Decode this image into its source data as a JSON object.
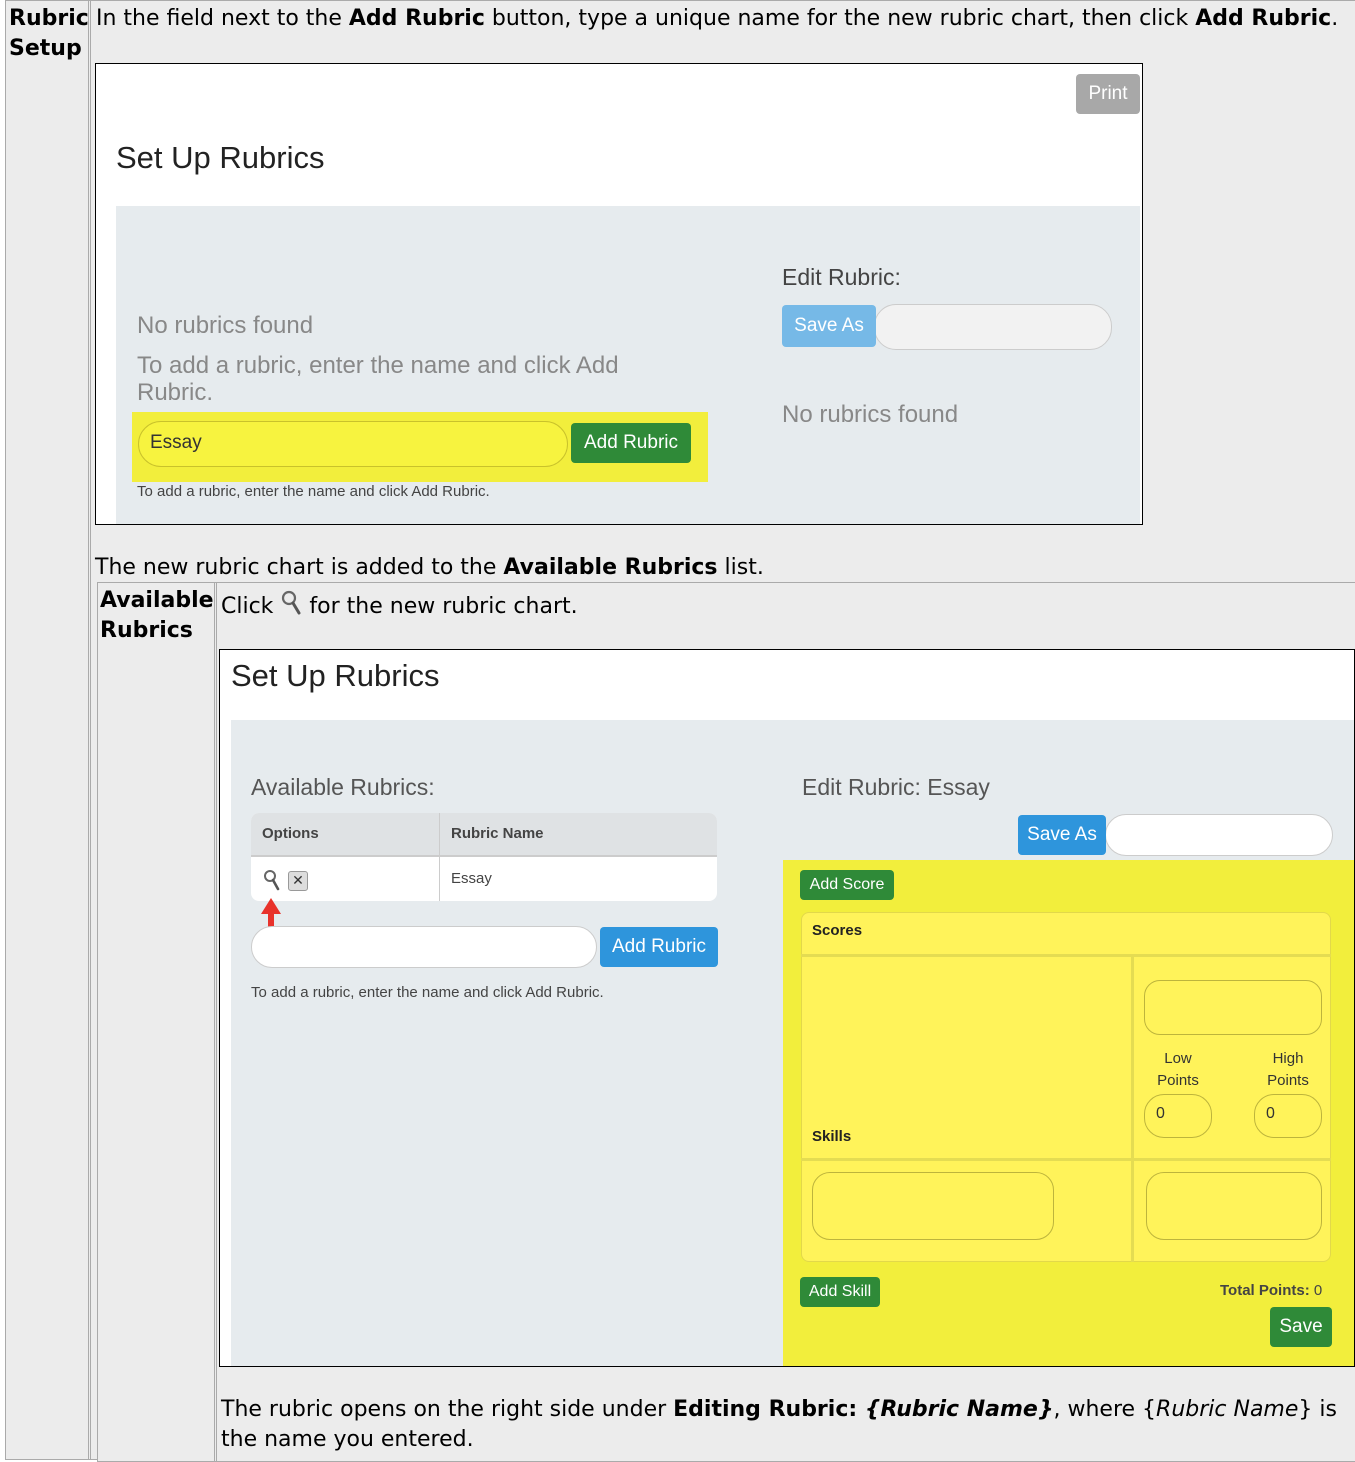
{
  "rubric_setup": {
    "heading_line1": "Rubric",
    "heading_line2": "Setup",
    "instruction_pre": "In the field next to the ",
    "instruction_bold1": "Add Rubric",
    "instruction_mid": " button, type a unique name for the new rubric chart, then click ",
    "instruction_bold2": "Add Rubric",
    "instruction_post": "."
  },
  "screenshot1": {
    "print_label": "Print",
    "title": "Set Up Rubrics",
    "no_rubrics": "No rubrics found",
    "add_hint_line1": "To add a rubric, enter the name and click Add",
    "add_hint_line2": "Rubric.",
    "name_input_value": "Essay",
    "add_rubric_label": "Add Rubric",
    "small_hint": "To add a rubric, enter the name and click Add Rubric.",
    "edit_rubric_label": "Edit Rubric:",
    "save_as_label": "Save As",
    "right_no_rubrics": "No rubrics found"
  },
  "after_add": {
    "text_pre": "The new rubric chart is added to the ",
    "text_bold": "Available Rubrics",
    "text_post": " list."
  },
  "available_rubrics": {
    "heading_line1": "Available",
    "heading_line2": "Rubrics",
    "instruction_pre": "Click ",
    "instruction_post": " for the new rubric chart."
  },
  "screenshot2": {
    "title": "Set Up Rubrics",
    "available_label": "Available Rubrics:",
    "columns": [
      "Options",
      "Rubric Name"
    ],
    "rows": [
      {
        "name": "Essay"
      }
    ],
    "add_rubric_label": "Add Rubric",
    "small_hint": "To add a rubric, enter the name and click Add Rubric.",
    "edit_label": "Edit Rubric: Essay",
    "save_as_label": "Save As",
    "add_score_label": "Add Score",
    "scores_label": "Scores",
    "skills_label": "Skills",
    "low_points_line1": "Low",
    "low_points_line2": "Points",
    "high_points_line1": "High",
    "high_points_line2": "Points",
    "low_value": "0",
    "high_value": "0",
    "add_skill_label": "Add Skill",
    "total_points_label": "Total Points:",
    "total_points_value": "0",
    "save_label": "Save"
  },
  "closing": {
    "line1_pre": "The rubric opens on the right side under ",
    "line1_bold": "Editing Rubric: ",
    "line1_bolditalic": "{Rubric Name}",
    "line1_mid": ", where {",
    "line1_italic": "Rubric Name",
    "line1_post": "} is",
    "line2": "the name you entered."
  },
  "colors": {
    "highlight_yellow": "#f2ee3c",
    "green_button": "#2f8a38",
    "blue_button": "#2e95dc",
    "arrow_red": "#e8322b"
  }
}
